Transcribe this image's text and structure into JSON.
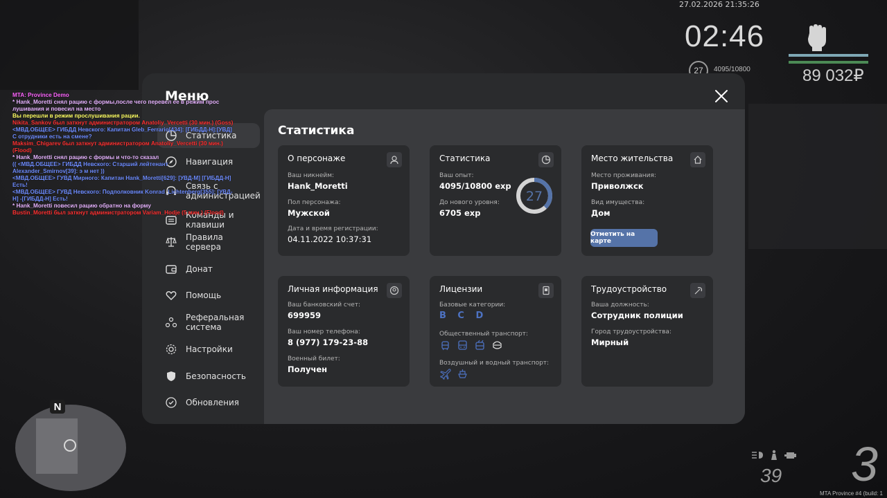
{
  "hud": {
    "datetime": "27.02.2026 21:35:26",
    "time": "02:46",
    "level": "27",
    "exp": "4095/10800",
    "money": "89 032₽",
    "gear": "3",
    "fuel": "39",
    "build": "MTA Province #4 (build: 1"
  },
  "chat": [
    {
      "text": "MTA: Province Demo",
      "color": "#ff66ff"
    },
    {
      "text": "* Hank_Moretti снял рацию с формы,после чего перевел ее в режим прос лушивания и повесил на место",
      "color": "#e7b4ff"
    },
    {
      "text": "Вы перешли в режим прослушивания рации.",
      "color": "#ffff66"
    },
    {
      "text": "Nikita_Sankov был заткнут администратором Anatoliy_Vercetti (30 мин.) (Goss)",
      "color": "#ff3333"
    },
    {
      "text": "<МВД.ОБЩЕЕ> ГИБДД Невского: Капитан Gleb_Ferrario[434]: [ГИБДД-Н]:[УВД] С отрудники есть на смене?",
      "color": "#6f8dff"
    },
    {
      "text": "Maksim_Chigarev был заткнут администратором Anatoliy_Vercetti (30 мин.) (Flood)",
      "color": "#ff3333"
    },
    {
      "text": "* Hank_Moretti снял рацию с формы и что-то сказал",
      "color": "#e7b4ff"
    },
    {
      "text": "(( <МВД.ОБЩЕЕ> ГИБДД Невского: Старший лейтенант Alexander_Smirnov[39]: э м нет ))",
      "color": "#6f8dff"
    },
    {
      "text": "<МВД.ОБЩЕЕ> ГУВД Мирного: Капитан Hank_Moretti[629]: [УВД-М] [ГИБДД-Н] Есть!",
      "color": "#6f8dff"
    },
    {
      "text": "<МВД.ОБЩЕЕ> ГУВД Невского: Подполковник Konrad_Lichtenberg[355]: [УВД-Н] -[ГИБДД-Н] Есть!",
      "color": "#6f8dff"
    },
    {
      "text": "* Hank_Moretti повесил рацию обратно на форму",
      "color": "#e7b4ff"
    },
    {
      "text": "Bustin_Moretti был заткнут администратором Variam_Hodje (5 мин.) (Flood)",
      "color": "#ff3333"
    }
  ],
  "menu": {
    "title": "Меню",
    "nav": [
      {
        "label": "Статистика",
        "icon": "pie-chart-icon",
        "active": true
      },
      {
        "label": "Навигация",
        "icon": "compass-icon",
        "active": false
      },
      {
        "label": "Связь с администрацией",
        "icon": "headset-icon",
        "active": false
      },
      {
        "label": "Команды и клавиши",
        "icon": "keyboard-icon",
        "active": false
      },
      {
        "label": "Правила сервера",
        "icon": "scales-icon",
        "active": false
      },
      {
        "label": "Донат",
        "icon": "wallet-icon",
        "active": false
      },
      {
        "label": "Помощь",
        "icon": "heart-hands-icon",
        "active": false
      },
      {
        "label": "Реферальная система",
        "icon": "people-network-icon",
        "active": false
      },
      {
        "label": "Настройки",
        "icon": "gear-icon",
        "active": false
      },
      {
        "label": "Безопасность",
        "icon": "shield-icon",
        "active": false
      },
      {
        "label": "Обновления",
        "icon": "refresh-icon",
        "active": false
      }
    ],
    "content_title": "Статистика",
    "character": {
      "title": "О персонаже",
      "nick_label": "Ваш никнейм:",
      "nick": "Hank_Moretti",
      "gender_label": "Пол персонажа:",
      "gender": "Мужской",
      "reg_label": "Дата и время регистрации:",
      "reg": "04.11.2022 10:37:31"
    },
    "stats": {
      "title": "Статистика",
      "exp_label": "Ваш опыт:",
      "exp": "4095/10800 exp",
      "next_label": "До нового уровня:",
      "next": "6705 exp",
      "level": "27",
      "progress": 0.379
    },
    "residence": {
      "title": "Место жительства",
      "place_label": "Место проживания:",
      "place": "Приволжск",
      "property_label": "Вид имущества:",
      "property": "Дом",
      "map_button": "Отметить на карте"
    },
    "personal": {
      "title": "Личная информация",
      "bank_label": "Ваш банковский счет:",
      "bank": "699959",
      "phone_label": "Ваш номер телефона:",
      "phone": "8 (977) 179-23-88",
      "military_label": "Военный билет:",
      "military": "Получен"
    },
    "licenses": {
      "title": "Лицензии",
      "base_label": "Базовые категории:",
      "base": "B C D",
      "public_label": "Общественный транспорт:",
      "air_label": "Воздушный и водный транспорт:"
    },
    "employment": {
      "title": "Трудоустройство",
      "position_label": "Ваша должность:",
      "position": "Сотрудник полиции",
      "city_label": "Город трудоустройства:",
      "city": "Мирный"
    }
  },
  "colors": {
    "accent": "#5573a8",
    "panel": "#2a2b2d",
    "content": "#3a3b3e",
    "license": "#4d72c2"
  }
}
